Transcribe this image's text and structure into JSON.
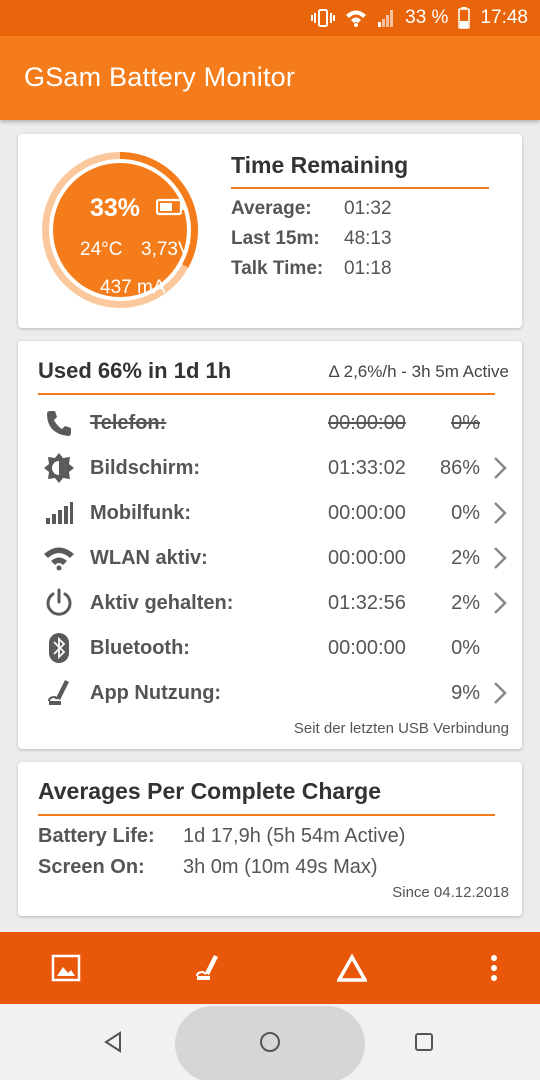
{
  "status_bar": {
    "battery_percent": "33 %",
    "time": "17:48",
    "icons": [
      "vibrate-icon",
      "wifi-icon",
      "cell-signal-icon",
      "battery-icon"
    ]
  },
  "app_bar": {
    "title": "GSam Battery Monitor"
  },
  "battery_gauge": {
    "percent": "33%",
    "level": 0.33,
    "temperature": "24°C",
    "voltage": "3,73V",
    "current": "437 mA"
  },
  "time_remaining": {
    "title": "Time Remaining",
    "rows": [
      {
        "label": "Average:",
        "value": "01:32"
      },
      {
        "label": "Last 15m:",
        "value": "48:13"
      },
      {
        "label": "Talk Time:",
        "value": "01:18"
      }
    ]
  },
  "usage": {
    "title": "Used 66% in 1d 1h",
    "rate": "Δ 2,6%/h - 3h 5m Active",
    "rows": [
      {
        "icon": "phone-icon",
        "name": "Telefon:",
        "time": "00:00:00",
        "percent": "0%",
        "strikethrough": true,
        "chevron": false
      },
      {
        "icon": "brightness-icon",
        "name": "Bildschirm:",
        "time": "01:33:02",
        "percent": "86%",
        "strikethrough": false,
        "chevron": true
      },
      {
        "icon": "signal-bars-icon",
        "name": "Mobilfunk:",
        "time": "00:00:00",
        "percent": "0%",
        "strikethrough": false,
        "chevron": true
      },
      {
        "icon": "wifi-icon",
        "name": "WLAN aktiv:",
        "time": "00:00:00",
        "percent": "2%",
        "strikethrough": false,
        "chevron": true
      },
      {
        "icon": "power-icon",
        "name": "Aktiv gehalten:",
        "time": "01:32:56",
        "percent": "2%",
        "strikethrough": false,
        "chevron": true
      },
      {
        "icon": "bluetooth-icon",
        "name": "Bluetooth:",
        "time": "00:00:00",
        "percent": "0%",
        "strikethrough": false,
        "chevron": false
      },
      {
        "icon": "app-usage-icon",
        "name": "App Nutzung:",
        "time": "",
        "percent": "9%",
        "strikethrough": false,
        "chevron": true
      }
    ],
    "footnote": "Seit der letzten USB Verbindung"
  },
  "averages": {
    "title": "Averages Per Complete Charge",
    "rows": [
      {
        "label": "Battery Life:",
        "value": "1d 17,9h (5h 54m Active)"
      },
      {
        "label": "Screen On:",
        "value": "3h 0m (10m 49s Max)"
      }
    ],
    "since": "Since 04.12.2018"
  },
  "bottom_bar": {
    "icons": [
      "image-icon",
      "app-usage-icon",
      "delta-icon",
      "overflow-menu-icon"
    ]
  },
  "nav_bar": {
    "icons": [
      "back-icon",
      "home-icon",
      "recents-icon"
    ]
  },
  "colors": {
    "primary": "#f57c1a",
    "dark": "#e8570a",
    "accent_line": "#f07a1c",
    "gauge_track": "#fbc79d"
  }
}
